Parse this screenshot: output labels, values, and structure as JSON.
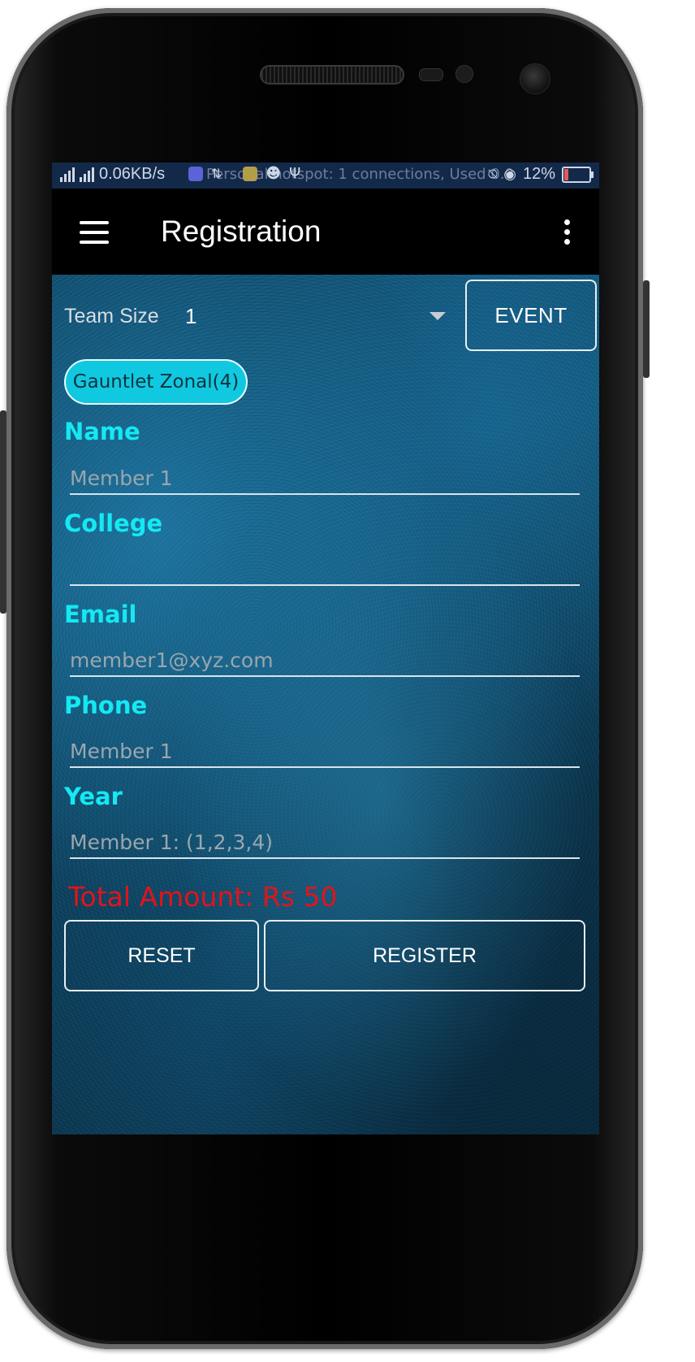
{
  "status_bar": {
    "speed": "0.06KB/s",
    "notice": "Personal hotspot: 1 connections, Used 0.0",
    "battery_percent": "12%",
    "background": "#13294a"
  },
  "app_bar": {
    "title": "Registration",
    "menu_icon": "hamburger-menu-icon",
    "overflow_icon": "more-vertical-icon"
  },
  "form": {
    "team_size_label": "Team Size",
    "team_size_value": "1",
    "event_button": "EVENT",
    "selected_event": "Gauntlet Zonal(4)",
    "fields": {
      "name": {
        "label": "Name",
        "placeholder": "Member 1"
      },
      "college": {
        "label": "College",
        "placeholder": ""
      },
      "email": {
        "label": "Email",
        "placeholder": "member1@xyz.com"
      },
      "phone": {
        "label": "Phone",
        "placeholder": "Member 1"
      },
      "year": {
        "label": "Year",
        "placeholder": "Member 1: (1,2,3,4)"
      }
    },
    "total_amount": "Total Amount: Rs 50",
    "reset_button": "RESET",
    "register_button": "REGISTER"
  },
  "colors": {
    "label_accent": "#14e9f3",
    "total_amount": "#e3131a",
    "chip_background": "#10c9e0"
  }
}
